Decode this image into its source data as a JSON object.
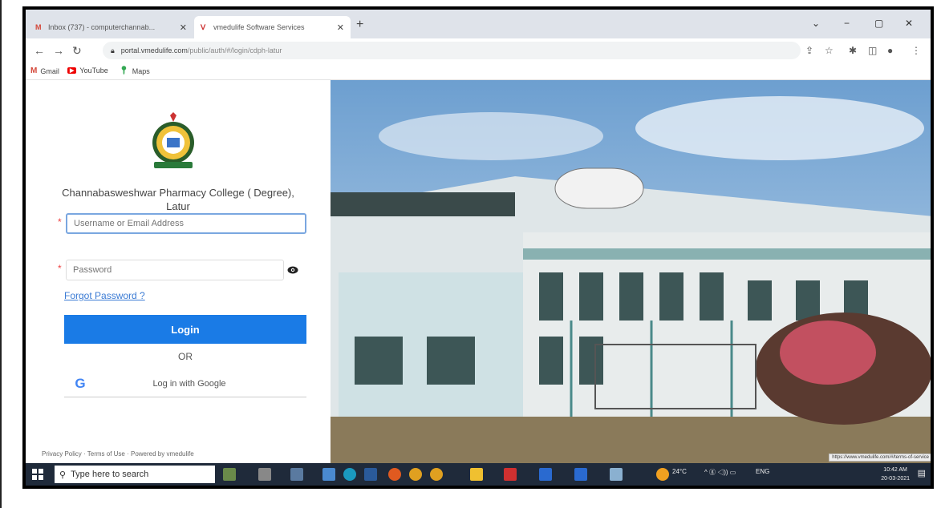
{
  "browser": {
    "tabs": [
      {
        "label": "Inbox (737) - computerchannab...",
        "icon": "gmail-icon"
      },
      {
        "label": "vmedulife Software Services",
        "icon": "vmedulife-icon"
      }
    ],
    "url_domain": "portal.vmedulife.com",
    "url_path": "/public/auth/#/login/cdph-latur",
    "bookmarks": [
      {
        "label": "Gmail",
        "icon": "gmail-icon"
      },
      {
        "label": "YouTube",
        "icon": "youtube-icon"
      },
      {
        "label": "Maps",
        "icon": "maps-icon"
      }
    ]
  },
  "login": {
    "college_name": "Channabasweshwar Pharmacy College ( Degree), Latur",
    "username_placeholder": "Username or Email Address",
    "password_placeholder": "Password",
    "forgot_link": "Forgot Password ?",
    "login_button": "Login",
    "or_text": "OR",
    "google_button": "Log in with Google",
    "footer": "Privacy Policy · Terms of Use · Powered by vmedulife"
  },
  "photo": {
    "status_url": "https://www.vmedulife.com/#/terms-of-service"
  },
  "taskbar": {
    "search_placeholder": "Type here to search",
    "weather": "24°C",
    "language": "ENG",
    "time": "10:42 AM",
    "date": "20-03-2021"
  },
  "colors": {
    "accent": "#1a7be6",
    "link": "#3b7bd4",
    "taskbar": "#1f2a3a"
  }
}
